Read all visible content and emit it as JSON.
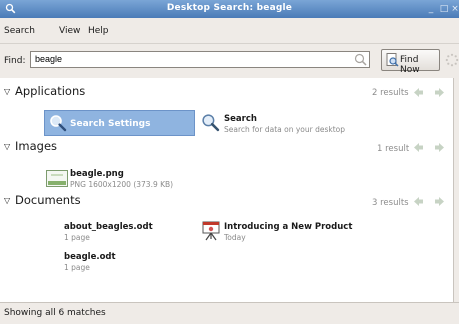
{
  "window": {
    "title": "Desktop Search: beagle",
    "minimize_glyph": "_",
    "maximize_glyph": "□",
    "close_glyph": "×"
  },
  "menu": {
    "search": "Search",
    "view": "View",
    "help": "Help"
  },
  "find": {
    "label": "Find:",
    "query": "beagle",
    "button": "Find Now"
  },
  "categories": [
    {
      "title": "Applications",
      "count": "2 results",
      "items": [
        {
          "title": "Search Settings",
          "icon": "search-icon",
          "selected": true
        },
        {
          "title": "Search",
          "subtitle": "Search for data on your desktop",
          "icon": "search-icon"
        }
      ]
    },
    {
      "title": "Images",
      "count": "1 result",
      "items": [
        {
          "title": "beagle.png",
          "subtitle": "PNG 1600x1200 (373.9 KB)",
          "icon": "image-thumbnail-icon"
        }
      ]
    },
    {
      "title": "Documents",
      "count": "3 results",
      "items": [
        {
          "title": "about_beagles.odt",
          "subtitle": "1 page"
        },
        {
          "title": "Introducing a New Product",
          "subtitle": "Today",
          "icon": "presentation-icon"
        },
        {
          "title": "beagle.odt",
          "subtitle": "1 page"
        }
      ]
    }
  ],
  "status": "Showing all 6 matches",
  "colors": {
    "titlebar": "#4a7bb7",
    "selection": "#8fb4e0",
    "chrome": "#efebe7"
  }
}
